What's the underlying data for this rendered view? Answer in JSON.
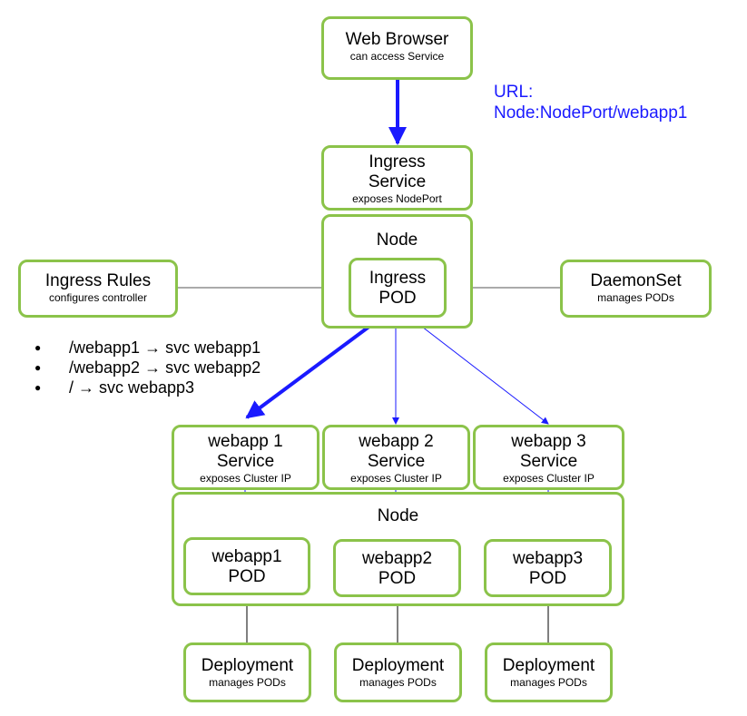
{
  "browser": {
    "title": "Web Browser",
    "subtitle": "can access Service"
  },
  "url_note": {
    "line1": "URL:",
    "line2": "Node:NodePort/webapp1"
  },
  "ingress_service": {
    "line1": "Ingress",
    "line2": "Service",
    "subtitle": "exposes NodePort"
  },
  "top_node": {
    "label": "Node",
    "pod": {
      "line1": "Ingress",
      "line2": "POD"
    }
  },
  "ingress_rules": {
    "title": "Ingress Rules",
    "subtitle": "configures controller"
  },
  "daemonset": {
    "title": "DaemonSet",
    "subtitle": "manages PODs"
  },
  "rules_list": [
    "/webapp1 → svc webapp1",
    "/webapp2 → svc webapp2",
    "/ → svc webapp3"
  ],
  "services": [
    {
      "line1": "webapp 1",
      "line2": "Service",
      "subtitle": "exposes Cluster IP"
    },
    {
      "line1": "webapp 2",
      "line2": "Service",
      "subtitle": "exposes Cluster IP"
    },
    {
      "line1": "webapp 3",
      "line2": "Service",
      "subtitle": "exposes Cluster IP"
    }
  ],
  "bottom_node": {
    "label": "Node"
  },
  "pods": [
    {
      "line1": "webapp1",
      "line2": "POD"
    },
    {
      "line1": "webapp2",
      "line2": "POD"
    },
    {
      "line1": "webapp3",
      "line2": "POD"
    }
  ],
  "deployments": [
    {
      "title": "Deployment",
      "subtitle": "manages PODs"
    },
    {
      "title": "Deployment",
      "subtitle": "manages PODs"
    },
    {
      "title": "Deployment",
      "subtitle": "manages PODs"
    }
  ],
  "colors": {
    "box_border": "#8bc34a",
    "arrow_blue": "#1a1aff",
    "arrow_gray": "#555555",
    "arrow_black": "#000000"
  }
}
